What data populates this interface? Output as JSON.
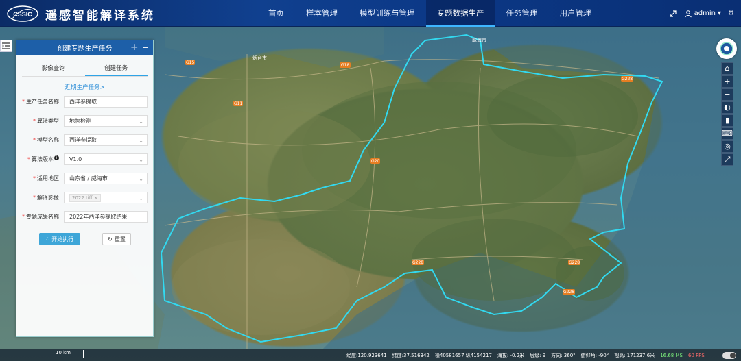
{
  "header": {
    "logo_text": "CSSIC",
    "title": "遥感智能解译系统",
    "nav": [
      "首页",
      "样本管理",
      "模型训练与管理",
      "专题数据生产",
      "任务管理",
      "用户管理"
    ],
    "active_nav": 3,
    "user": "admin"
  },
  "panel": {
    "title": "创建专题生产任务",
    "tabs": [
      "影像查询",
      "创建任务"
    ],
    "active_tab": 1,
    "recent_link": "近期生产任务>",
    "fields": {
      "task_name": {
        "label": "生产任务名称",
        "value": "西洋参提取"
      },
      "algorithm_type": {
        "label": "算法类型",
        "value": "地物检测"
      },
      "model_name": {
        "label": "模型名称",
        "value": "西洋参提取"
      },
      "algorithm_version": {
        "label": "算法版本",
        "value": "V1.0"
      },
      "region": {
        "label": "适用地区",
        "value": "山东省 / 威海市"
      },
      "imagery": {
        "label": "解译影像",
        "value": "2022.tiff"
      },
      "result_name": {
        "label": "专题成果名称",
        "value": "2022年西洋参提取结果"
      }
    },
    "run_button": "开始执行",
    "reset_button": "重置"
  },
  "map": {
    "labels": [
      {
        "text": "烟台市"
      },
      {
        "text": "威海市"
      },
      {
        "text": "G18"
      },
      {
        "text": "G228"
      },
      {
        "text": "G15"
      },
      {
        "text": "G11"
      },
      {
        "text": "G20"
      },
      {
        "text": "G228"
      },
      {
        "text": "G228"
      },
      {
        "text": "G228"
      }
    ]
  },
  "status": {
    "scale": "10 km",
    "longitude": "经度:120.923641",
    "latitude": "纬度:37.516342",
    "grid": "横40581657 纵4154217",
    "altitude": "海拔: -0.2米",
    "level": "层级: 9",
    "heading": "方向: 360°",
    "pitch": "俯仰角: -90°",
    "view_height": "视高: 171237.6米",
    "ms": "16.68 MS",
    "fps": "60 FPS"
  }
}
